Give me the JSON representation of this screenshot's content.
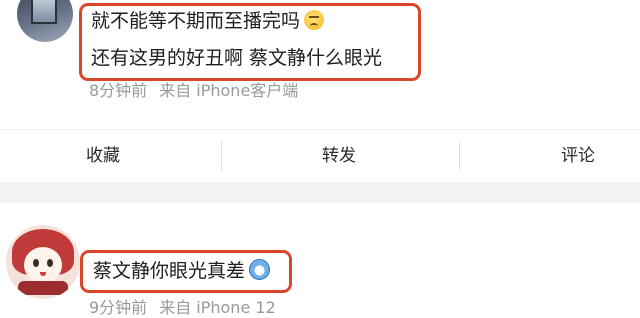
{
  "comment1": {
    "line1": "就不能等不期而至播完吗",
    "line1_emoji": "sweat-face-emoji",
    "line2": "还有这男的好丑啊 蔡文静什么眼光",
    "time": "8分钟前",
    "source": "来自 iPhone客户端"
  },
  "actions": {
    "favorite": "收藏",
    "forward": "转发",
    "comment": "评论"
  },
  "comment2": {
    "text": "蔡文静你眼光真差",
    "emoji": "doraemon-emoji",
    "time": "9分钟前",
    "source": "来自 iPhone 12"
  },
  "colors": {
    "highlight": "#d9472a",
    "meta_text": "#9a9a9a"
  }
}
